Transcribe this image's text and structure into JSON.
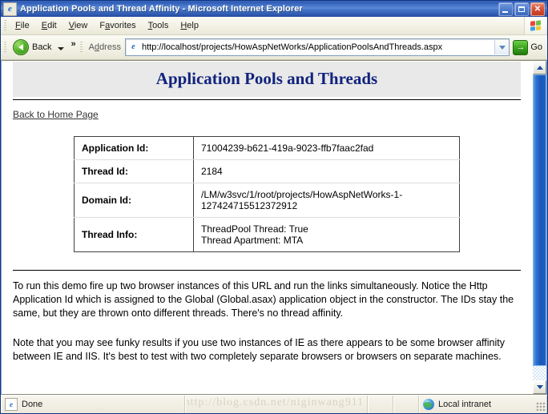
{
  "window": {
    "title": "Application Pools and Thread Affinity - Microsoft Internet Explorer",
    "ie_glyph": "e",
    "controls": {
      "minimize": "minimize-button",
      "maximize": "maximize-button",
      "close": "✕"
    }
  },
  "menu": {
    "items": [
      {
        "label": "File",
        "accesskey": "F",
        "rest": "ile"
      },
      {
        "label": "Edit",
        "accesskey": "E",
        "rest": "dit"
      },
      {
        "label": "View",
        "accesskey": "V",
        "rest": "iew"
      },
      {
        "label": "Favorites",
        "pre": "F",
        "accesskey": "a",
        "rest": "vorites"
      },
      {
        "label": "Tools",
        "accesskey": "T",
        "rest": "ools"
      },
      {
        "label": "Help",
        "accesskey": "H",
        "rest": "elp"
      }
    ],
    "logo": "windows-flag-logo"
  },
  "toolbar": {
    "back_label": "Back",
    "overflow_label": "»",
    "address_label": "Address",
    "url": "http://localhost/projects/HowAspNetWorks/ApplicationPoolsAndThreads.aspx",
    "go_label": "Go",
    "go_arrow": "→"
  },
  "page": {
    "heading": "Application Pools and Threads",
    "home_link": "Back to Home Page",
    "table": {
      "rows": [
        {
          "key": "Application Id:",
          "value": "71004239-b621-419a-9023-ffb7faac2fad",
          "value2": ""
        },
        {
          "key": "Thread Id:",
          "value": "2184",
          "value2": ""
        },
        {
          "key": "Domain Id:",
          "value": "/LM/w3svc/1/root/projects/HowAspNetWorks-1-",
          "value2": "127424715512372912"
        },
        {
          "key": "Thread Info:",
          "value": "ThreadPool Thread: True",
          "value2": "Thread Apartment: MTA"
        }
      ]
    },
    "paragraph1": "To run this demo fire up two browser instances of this URL and run the links simultaneously. Notice the Http Application Id which is assigned to the Global (Global.asax) application object in the constructor. The IDs stay the same, but they are thrown onto different threads. There's no thread affinity.",
    "paragraph2": "Note that you may see funky results if you use two instances of IE as there appears to be some browser affinity between IE and IIS. It's best to test with two completely separate browsers or browsers on separate machines."
  },
  "statusbar": {
    "status": "Done",
    "zone": "Local intranet",
    "watermark": "http://blog.csdn.net/niginwang911"
  },
  "colors": {
    "title_gradient_start": "#3d6ac0",
    "title_gradient_end": "#23499f",
    "heading_text": "#11237d",
    "heading_band": "#e9e9e9",
    "scrollbar_thumb": "#1757b8",
    "go_green": "#3da81f",
    "back_green": "#52b326",
    "close_red": "#d9543a"
  }
}
